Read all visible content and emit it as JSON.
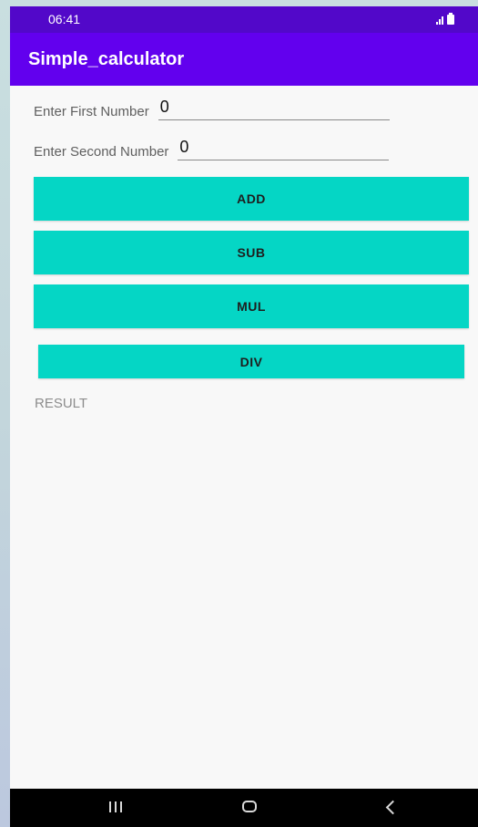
{
  "status_bar": {
    "time": "06:41",
    "icons": [
      "signal-icon",
      "battery-icon"
    ]
  },
  "app_bar": {
    "title": "Simple_calculator"
  },
  "form": {
    "first_number": {
      "label": "Enter First Number",
      "value": "0"
    },
    "second_number": {
      "label": "Enter Second Number",
      "value": "0"
    }
  },
  "buttons": {
    "add": "ADD",
    "sub": "SUB",
    "mul": "MUL",
    "div": "DIV"
  },
  "result": {
    "text": "RESULT"
  },
  "nav_bar": {
    "icons": [
      "recent-apps-icon",
      "home-icon",
      "back-icon"
    ]
  },
  "colors": {
    "status_bar": "#5208c9",
    "app_bar": "#6200ee",
    "button": "#05d6c5",
    "background": "#f8f8f8",
    "nav_bar": "#000000"
  }
}
